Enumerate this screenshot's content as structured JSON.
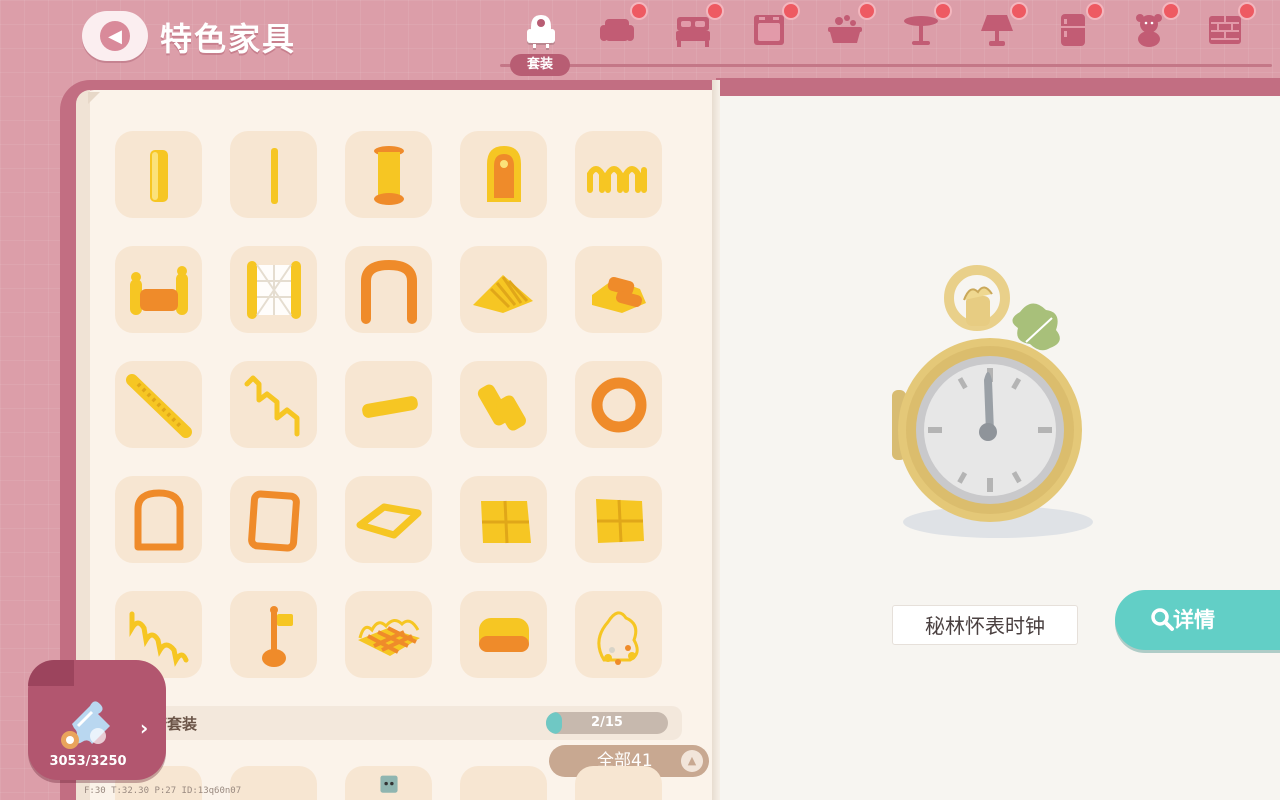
{
  "header": {
    "title": "特色家具",
    "back_label": "back"
  },
  "categories": [
    {
      "name": "armchair-set-icon",
      "label": "套装",
      "active": true
    },
    {
      "name": "sofa-icon",
      "dot": true
    },
    {
      "name": "bed-icon",
      "dot": true
    },
    {
      "name": "cabinet-icon",
      "dot": true
    },
    {
      "name": "bathtub-icon",
      "dot": true
    },
    {
      "name": "table-icon",
      "dot": true
    },
    {
      "name": "lamp-icon",
      "dot": true
    },
    {
      "name": "fridge-icon",
      "dot": true
    },
    {
      "name": "teddy-bear-icon",
      "dot": true
    },
    {
      "name": "brick-wall-icon",
      "dot": true
    }
  ],
  "set": {
    "name": "糖套装",
    "progress_text": "2/15",
    "progress": 0.133
  },
  "filter": {
    "label": "全部41"
  },
  "currency": {
    "count": "3053/3250"
  },
  "item": {
    "name": "秘林怀表时钟",
    "details_label": "详情"
  },
  "debug": "F:30   T:32.30   P:27   ID:13q60n07",
  "colors": {
    "accent": "#62cfc6",
    "frame": "#c26e82",
    "slot": "#f7e6d2",
    "item_yellow": "#f6c623",
    "item_orange": "#ef8b2a"
  }
}
